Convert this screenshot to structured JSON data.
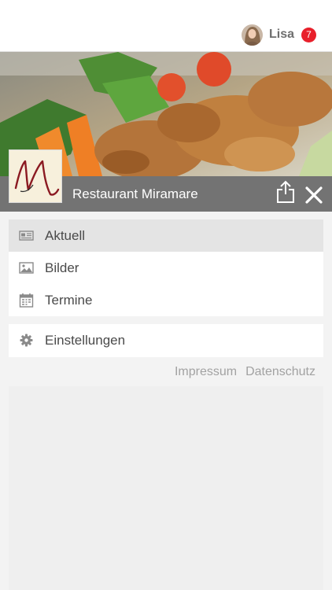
{
  "user": {
    "name": "Lisa",
    "notifications": "7"
  },
  "restaurant": {
    "name": "Restaurant Miramare",
    "logo_letter": "M"
  },
  "menu": {
    "items": [
      {
        "label": "Aktuell",
        "icon": "newspaper-icon"
      },
      {
        "label": "Bilder",
        "icon": "image-icon"
      },
      {
        "label": "Termine",
        "icon": "calendar-icon"
      }
    ],
    "settings": {
      "label": "Einstellungen",
      "icon": "gear-icon"
    }
  },
  "footer": {
    "impressum": "Impressum",
    "datenschutz": "Datenschutz"
  },
  "colors": {
    "badge": "#e8202b",
    "titlebar": "#737373",
    "active_item": "#e4e4e4",
    "logo_bg": "#f7f0dc",
    "logo_stroke": "#8b1a22"
  }
}
